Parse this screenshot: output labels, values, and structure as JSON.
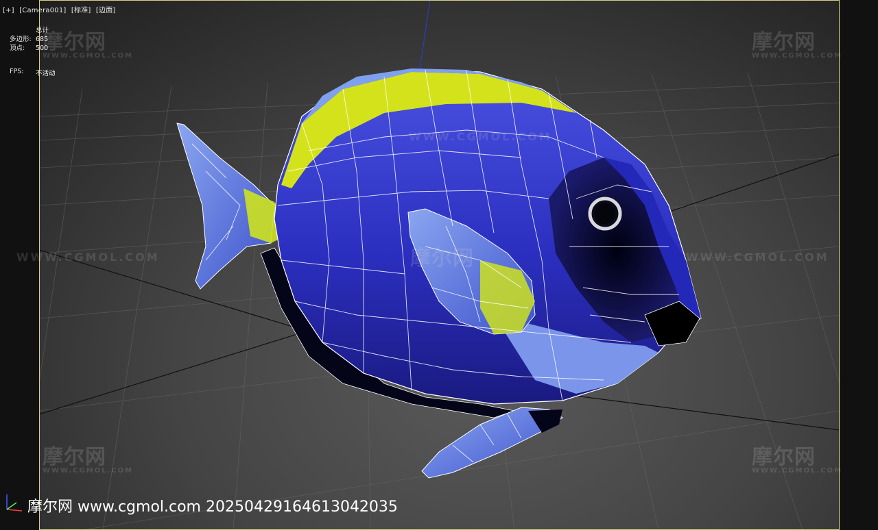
{
  "viewport": {
    "label_items": [
      "[+]",
      "[Camera001]",
      "[标准]",
      "[边面]"
    ]
  },
  "stats": {
    "header": "总计",
    "polygons_label": "多边形:",
    "polygons_value": "685",
    "vertices_label": "顶点:",
    "vertices_value": "500",
    "fps_label": "FPS:",
    "fps_value": "不活动"
  },
  "watermarks": {
    "logo": "摩尔网",
    "logo_sub": "WWW.CGMOL.COM",
    "url": "WWW.CGMOL.COM"
  },
  "footer": {
    "text": "摩尔网 www.cgmol.com 20250429164613042035"
  },
  "colors": {
    "viewport_border": "#d8d27a",
    "fish_body": "#2e34c8",
    "fish_stripe": "#d4e21c",
    "fish_light": "#6f8fe8",
    "wire": "#ffffff"
  },
  "icons": {
    "axis": "axis-gizmo-icon"
  }
}
